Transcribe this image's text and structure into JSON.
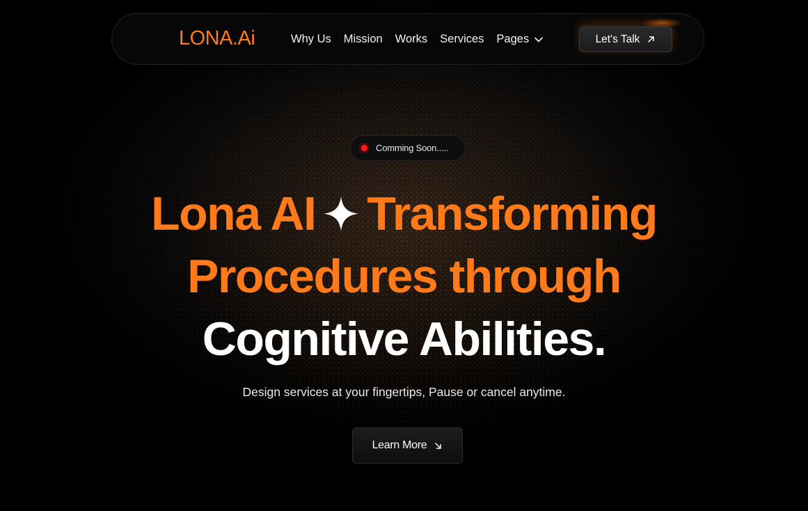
{
  "brand": {
    "logo": "LONA.Ai",
    "accent_color": "#ff7a1a"
  },
  "nav": {
    "items": [
      {
        "label": "Why Us"
      },
      {
        "label": "Mission"
      },
      {
        "label": "Works"
      },
      {
        "label": "Services"
      }
    ],
    "pages_label": "Pages",
    "pages_icon": "chevron-down-icon",
    "cta_label": "Let's Talk",
    "cta_icon": "arrow-up-right-icon"
  },
  "hero": {
    "badge_text": "Comming Soon.....",
    "badge_dot_color": "#ff1a1a",
    "headline_part1": "Lona AI",
    "headline_icon": "sparkle-icon",
    "headline_part2": "Transforming",
    "headline_line2": "Procedures through",
    "headline_line3": "Cognitive Abilities.",
    "subtitle": "Design services at your fingertips, Pause or cancel anytime.",
    "button_label": "Learn More",
    "button_icon": "arrow-down-right-icon"
  }
}
